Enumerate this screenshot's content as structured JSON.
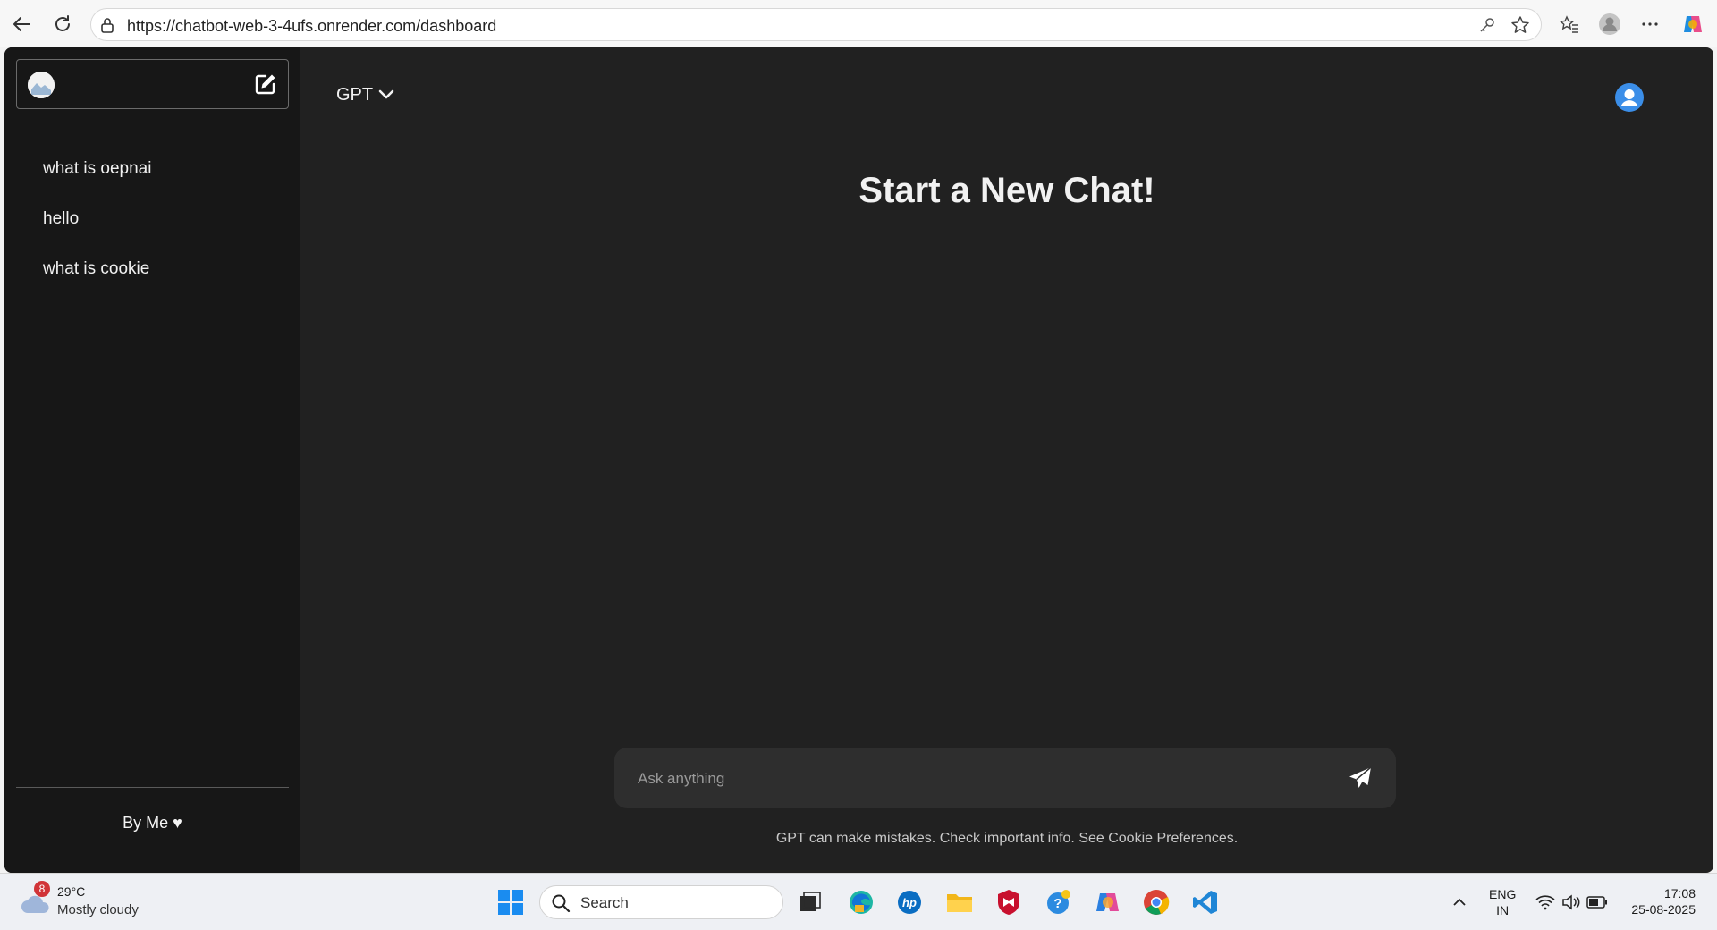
{
  "browser": {
    "url": "https://chatbot-web-3-4ufs.onrender.com/dashboard",
    "icons": [
      "back-icon",
      "refresh-icon",
      "lock-icon",
      "key-icon",
      "star-icon",
      "favorites-icon",
      "profile-icon",
      "more-icon",
      "copilot-icon"
    ]
  },
  "sidebar": {
    "history": [
      {
        "label": "what is oepnai"
      },
      {
        "label": "hello"
      },
      {
        "label": "what is cookie"
      }
    ],
    "footer": "By Me ♥"
  },
  "main": {
    "model": "GPT",
    "headline": "Start a New Chat!",
    "input_placeholder": "Ask anything",
    "disclaimer": "GPT can make mistakes. Check important info. See Cookie Preferences."
  },
  "taskbar": {
    "weather_badge": "8",
    "temperature": "29°C",
    "condition": "Mostly cloudy",
    "search_label": "Search",
    "lang_line1": "ENG",
    "lang_line2": "IN",
    "time": "17:08",
    "date": "25-08-2025"
  },
  "colors": {
    "app_bg": "#212121",
    "sidebar_bg": "#171717",
    "composer_bg": "#2e2e2e",
    "accent_user": "#3b8ee8"
  }
}
